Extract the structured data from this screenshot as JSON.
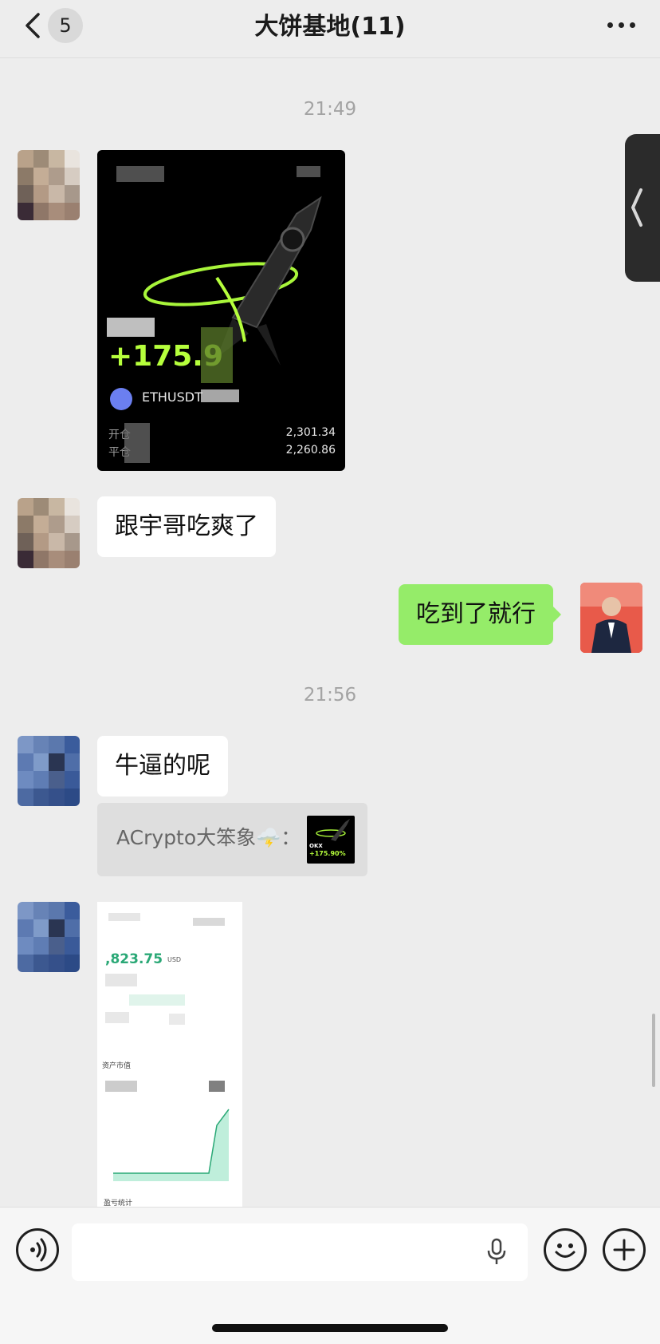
{
  "header": {
    "back_icon": "chevron-left-icon",
    "unread_count": "5",
    "title": "大饼基地(11)",
    "more_icon": "ellipsis-icon"
  },
  "messages": {
    "time_1": "21:49",
    "time_2": "21:56",
    "image_1": {
      "pnl": "+175.9",
      "pair": "ETHUSDT",
      "open_label": "开仓",
      "close_label": "平仓",
      "open_price": "2,301.34",
      "close_price": "2,260.86"
    },
    "text_1": "跟宇哥吃爽了",
    "text_2": "吃到了就行",
    "text_3": "牛逼的呢",
    "quote": {
      "text": "ACrypto大笨象🌩️：",
      "thumb_brand": "OKX",
      "thumb_pnl": "+175.90%"
    },
    "image_2": {
      "amount": ",823.75",
      "currency": "USD",
      "section_label": "资产市值",
      "section_label_2": "盈亏统计"
    }
  },
  "input_bar": {
    "voice_icon": "voice-icon",
    "mic_icon": "microphone-icon",
    "emoji_icon": "emoji-icon",
    "plus_icon": "plus-icon"
  },
  "colors": {
    "background": "#ededed",
    "self_bubble": "#95ec69",
    "other_bubble": "#ffffff",
    "pnl_green": "#b6ff3c"
  }
}
